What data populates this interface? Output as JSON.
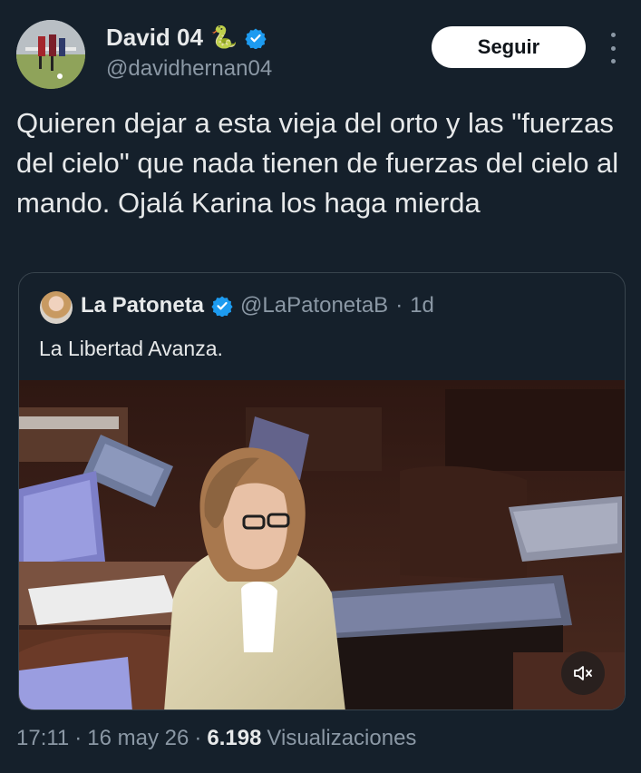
{
  "author": {
    "name": "David 04",
    "emoji": "🐍",
    "handle": "@davidhernan04",
    "verified_color": "#1d9bf0"
  },
  "actions": {
    "follow_label": "Seguir"
  },
  "tweet": {
    "text": "Quieren dejar a esta vieja del orto y las \"fuerzas del cielo\" que nada tienen de fuerzas del cielo al mando. Ojalá Karina los haga mierda"
  },
  "quoted": {
    "name": "La Patoneta",
    "handle": "@LaPatonetaB",
    "separator": "·",
    "time": "1d",
    "text": "La Libertad Avanza."
  },
  "meta": {
    "time": "17:11",
    "sep1": "·",
    "date": "16 may 26",
    "sep2": "·",
    "views_count": "6.198",
    "views_label": "Visualizaciones"
  },
  "colors": {
    "background": "#15202b",
    "text_primary": "#e7e9ea",
    "text_secondary": "#8b98a5",
    "accent": "#1d9bf0"
  },
  "icons": {
    "verified": "verified-badge-icon",
    "more": "more-options-icon",
    "mute": "muted-speaker-icon"
  }
}
